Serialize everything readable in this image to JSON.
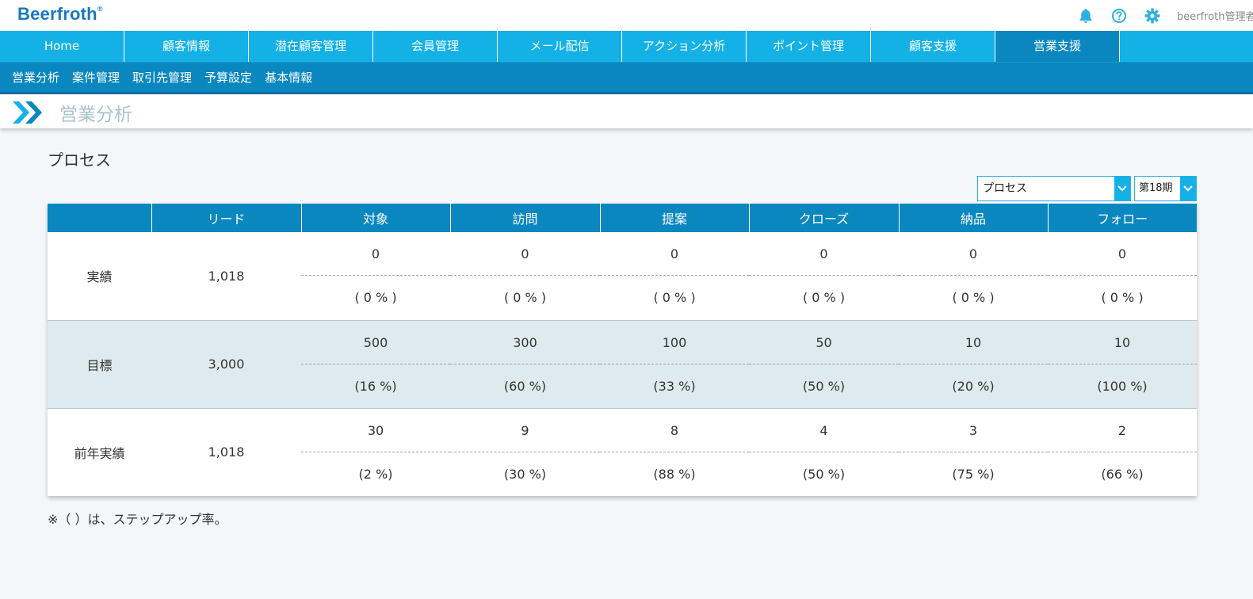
{
  "app": {
    "logo_text": "Beerfroth",
    "logo_mark": "®",
    "user_name": "beerfroth管理者"
  },
  "top_icons": [
    "bell-icon",
    "help-icon",
    "gear-icon"
  ],
  "nav": {
    "items": [
      {
        "label": "Home",
        "active": false
      },
      {
        "label": "顧客情報",
        "active": false
      },
      {
        "label": "潜在顧客管理",
        "active": false
      },
      {
        "label": "会員管理",
        "active": false
      },
      {
        "label": "メール配信",
        "active": false
      },
      {
        "label": "アクション分析",
        "active": false
      },
      {
        "label": "ポイント管理",
        "active": false
      },
      {
        "label": "顧客支援",
        "active": false
      },
      {
        "label": "営業支援",
        "active": true
      }
    ]
  },
  "subnav": {
    "items": [
      {
        "label": "営業分析"
      },
      {
        "label": "案件管理"
      },
      {
        "label": "取引先管理"
      },
      {
        "label": "予算設定"
      },
      {
        "label": "基本情報"
      }
    ]
  },
  "page": {
    "title": "営業分析",
    "section_title": "プロセス"
  },
  "filters": {
    "type_select": "プロセス",
    "period_select": "第18期"
  },
  "table": {
    "headers": [
      "",
      "リード",
      "対象",
      "訪問",
      "提案",
      "クローズ",
      "納品",
      "フォロー"
    ],
    "rows": [
      {
        "label": "実績",
        "lead": "1,018",
        "cells": [
          {
            "value": "0",
            "rate": "( 0 % )"
          },
          {
            "value": "0",
            "rate": "( 0 % )"
          },
          {
            "value": "0",
            "rate": "( 0 % )"
          },
          {
            "value": "0",
            "rate": "( 0 % )"
          },
          {
            "value": "0",
            "rate": "( 0 % )"
          },
          {
            "value": "0",
            "rate": "( 0 % )"
          }
        ]
      },
      {
        "label": "目標",
        "lead": "3,000",
        "cells": [
          {
            "value": "500",
            "rate": "(16 %)"
          },
          {
            "value": "300",
            "rate": "(60 %)"
          },
          {
            "value": "100",
            "rate": "(33 %)"
          },
          {
            "value": "50",
            "rate": "(50 %)"
          },
          {
            "value": "10",
            "rate": "(20 %)"
          },
          {
            "value": "10",
            "rate": "(100 %)"
          }
        ]
      },
      {
        "label": "前年実績",
        "lead": "1,018",
        "cells": [
          {
            "value": "30",
            "rate": "(2 %)"
          },
          {
            "value": "9",
            "rate": "(30 %)"
          },
          {
            "value": "8",
            "rate": "(88 %)"
          },
          {
            "value": "4",
            "rate": "(50 %)"
          },
          {
            "value": "3",
            "rate": "(75 %)"
          },
          {
            "value": "2",
            "rate": "(66 %)"
          }
        ]
      }
    ]
  },
  "footnote": "※（ ）は、ステップアップ率。"
}
